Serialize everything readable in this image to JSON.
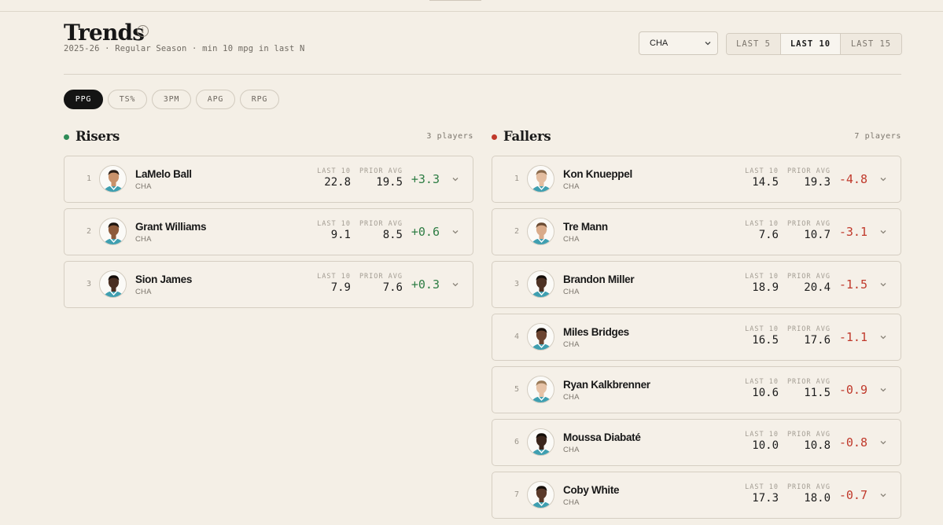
{
  "header": {
    "title": "Trends",
    "info_icon": "i",
    "subtitle": "2025-26 · Regular Season · min 10 mpg in last N",
    "team_select": "CHA",
    "ranges": [
      {
        "label": "LAST 5",
        "active": false
      },
      {
        "label": "LAST 10",
        "active": true
      },
      {
        "label": "LAST 15",
        "active": false
      }
    ]
  },
  "stat_tabs": [
    {
      "label": "PPG",
      "active": true
    },
    {
      "label": "TS%",
      "active": false
    },
    {
      "label": "3PM",
      "active": false
    },
    {
      "label": "APG",
      "active": false
    },
    {
      "label": "RPG",
      "active": false
    }
  ],
  "columns": {
    "last_label": "LAST 10",
    "prior_label": "PRIOR AVG",
    "risers": {
      "title": "Risers",
      "count": "3 players",
      "dot_color": "#2e8b57",
      "players": [
        {
          "rank": "1",
          "name": "LaMelo Ball",
          "team": "CHA",
          "last": "22.8",
          "prior": "19.5",
          "delta": "+3.3"
        },
        {
          "rank": "2",
          "name": "Grant Williams",
          "team": "CHA",
          "last": "9.1",
          "prior": "8.5",
          "delta": "+0.6"
        },
        {
          "rank": "3",
          "name": "Sion James",
          "team": "CHA",
          "last": "7.9",
          "prior": "7.6",
          "delta": "+0.3"
        }
      ]
    },
    "fallers": {
      "title": "Fallers",
      "count": "7 players",
      "dot_color": "#c0392b",
      "players": [
        {
          "rank": "1",
          "name": "Kon Knueppel",
          "team": "CHA",
          "last": "14.5",
          "prior": "19.3",
          "delta": "-4.8"
        },
        {
          "rank": "2",
          "name": "Tre Mann",
          "team": "CHA",
          "last": "7.6",
          "prior": "10.7",
          "delta": "-3.1"
        },
        {
          "rank": "3",
          "name": "Brandon Miller",
          "team": "CHA",
          "last": "18.9",
          "prior": "20.4",
          "delta": "-1.5"
        },
        {
          "rank": "4",
          "name": "Miles Bridges",
          "team": "CHA",
          "last": "16.5",
          "prior": "17.6",
          "delta": "-1.1"
        },
        {
          "rank": "5",
          "name": "Ryan Kalkbrenner",
          "team": "CHA",
          "last": "10.6",
          "prior": "11.5",
          "delta": "-0.9"
        },
        {
          "rank": "6",
          "name": "Moussa Diabaté",
          "team": "CHA",
          "last": "10.0",
          "prior": "10.8",
          "delta": "-0.8"
        },
        {
          "rank": "7",
          "name": "Coby White",
          "team": "CHA",
          "last": "17.3",
          "prior": "18.0",
          "delta": "-0.7"
        }
      ]
    }
  },
  "icons": {
    "info": "info-icon",
    "select_chevron": "chevron-down-icon",
    "row_expand": "chevron-down-icon",
    "avatar": "player-headshot-icon"
  }
}
